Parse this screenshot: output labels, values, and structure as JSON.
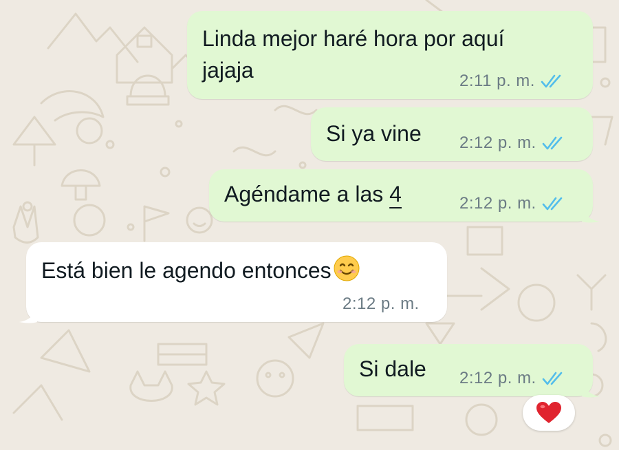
{
  "messages": [
    {
      "text_line1": "Linda mejor haré hora por aquí",
      "text_line2": "jajaja",
      "time": "2:11 p. m.",
      "direction": "outgoing",
      "status_icon": "double-check-read-icon"
    },
    {
      "text": "Si ya vine",
      "time": "2:12 p. m.",
      "direction": "outgoing",
      "status_icon": "double-check-read-icon"
    },
    {
      "text_prefix": "Agéndame a las ",
      "text_number": "4",
      "time": "2:12 p. m.",
      "direction": "outgoing",
      "status_icon": "double-check-read-icon"
    },
    {
      "text": "Está bien le agendo entonces",
      "emoji": "smiling-face-icon",
      "time": "2:12 p. m.",
      "direction": "incoming"
    },
    {
      "text": "Si dale",
      "time": "2:12 p. m.",
      "direction": "outgoing",
      "status_icon": "double-check-read-icon",
      "reaction": "red-heart-icon"
    }
  ],
  "colors": {
    "outgoing_bubble": "#e1f8d3",
    "incoming_bubble": "#ffffff",
    "wallpaper": "#efeae2",
    "read_ticks": "#53bdeb",
    "timestamp": "#6b7b84"
  }
}
